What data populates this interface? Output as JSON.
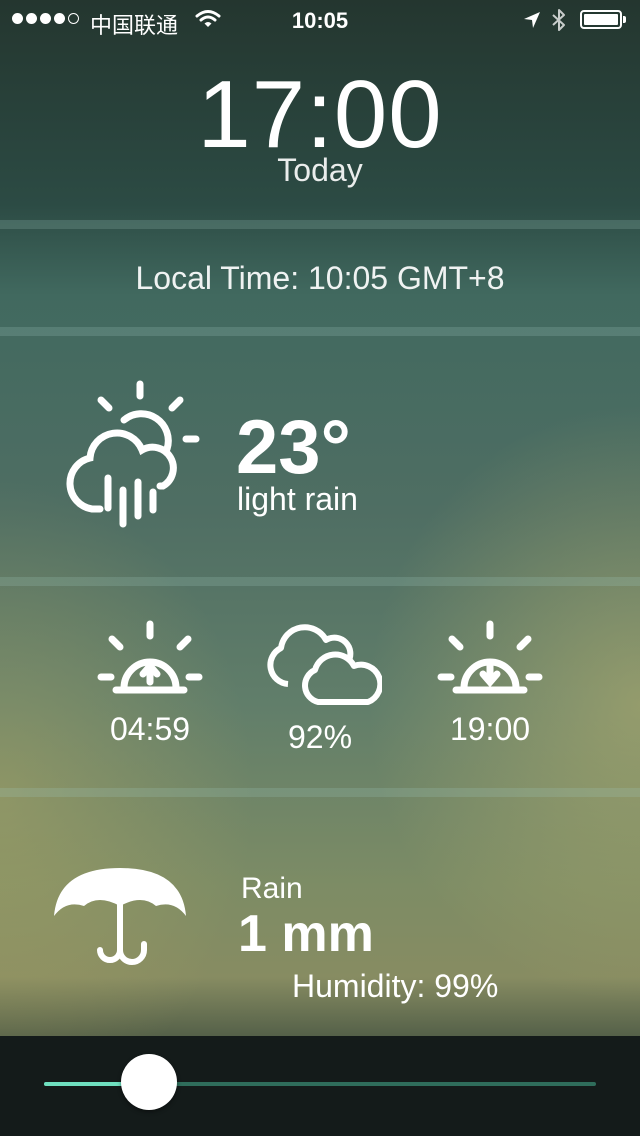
{
  "status_bar": {
    "carrier": "中国联通",
    "time": "10:05"
  },
  "header": {
    "time": "17:00",
    "day": "Today"
  },
  "local_time": "Local Time: 10:05 GMT+8",
  "current": {
    "icon": "sun-cloud-rain-icon",
    "temperature": "23°",
    "condition": "light rain"
  },
  "stats": {
    "sunrise": {
      "icon": "sunrise-icon",
      "value": "04:59"
    },
    "cloud_cover": {
      "icon": "clouds-icon",
      "value": "92%"
    },
    "sunset": {
      "icon": "sunset-icon",
      "value": "19:00"
    }
  },
  "precipitation": {
    "icon": "umbrella-icon",
    "label": "Rain",
    "value": "1 mm",
    "humidity": "Humidity: 99%"
  },
  "time_slider": {
    "position_fraction": 0.19,
    "track_color": "#2f6d5b",
    "filled_color": "#6fe0bf"
  }
}
